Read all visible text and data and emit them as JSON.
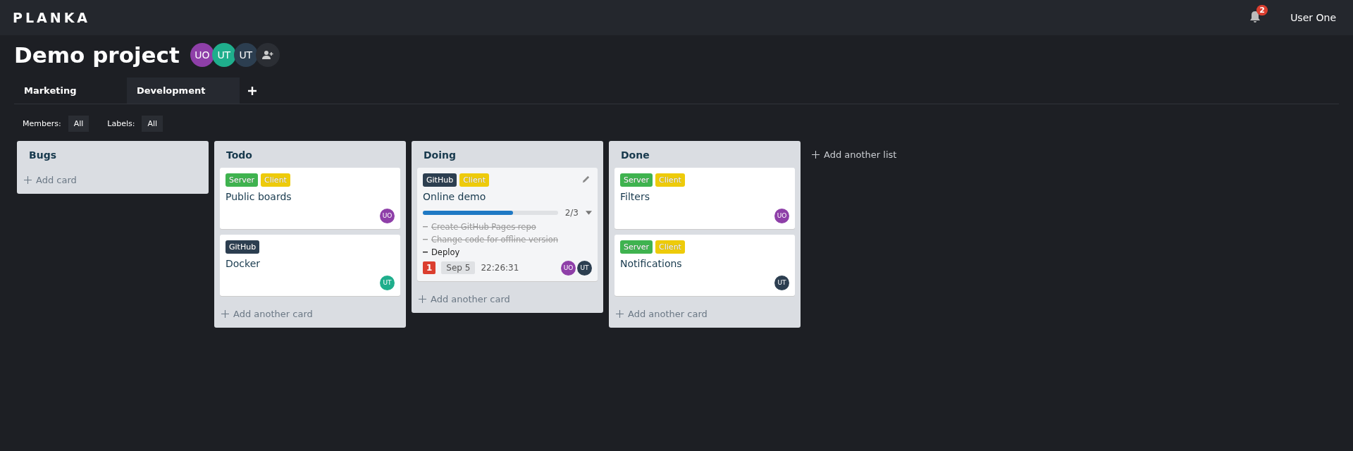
{
  "header": {
    "logo": "PLANKA",
    "notifications": "2",
    "user": "User One"
  },
  "project": {
    "title": "Demo project",
    "members": [
      {
        "initials": "UO",
        "color": "#8e3fa8"
      },
      {
        "initials": "UT",
        "color": "#1fae8c"
      },
      {
        "initials": "UT",
        "color": "#2c3e50"
      }
    ]
  },
  "tabs": [
    {
      "label": "Marketing",
      "selected": false
    },
    {
      "label": "Development",
      "selected": true
    }
  ],
  "filters": [
    {
      "label": "Members:",
      "value": "All"
    },
    {
      "label": "Labels:",
      "value": "All"
    }
  ],
  "lists": [
    {
      "title": "Bugs",
      "add": "Add card"
    },
    {
      "title": "Todo",
      "add": "Add another card",
      "cards": [
        {
          "labels": [
            {
              "text": "Server",
              "color": "#3fb34f"
            },
            {
              "text": "Client",
              "color": "#eecb0a"
            }
          ],
          "title": "Public boards",
          "hovered": false,
          "members": [
            {
              "initials": "UO",
              "color": "#8e3fa8"
            }
          ]
        },
        {
          "labels": [
            {
              "text": "GitHub",
              "color": "#2c3e50"
            }
          ],
          "title": "Docker",
          "hovered": false,
          "members": [
            {
              "initials": "UT",
              "color": "#1fae8c"
            }
          ]
        }
      ]
    },
    {
      "title": "Doing",
      "add": "Add another card",
      "cards": [
        {
          "labels": [
            {
              "text": "GitHub",
              "color": "#2c3e50"
            },
            {
              "text": "Client",
              "color": "#eecb0a"
            }
          ],
          "title": "Online demo",
          "hovered": true,
          "progress": {
            "level": 0.667,
            "reading": "2/3"
          },
          "tasks": [
            {
              "text": "Create GitHub Pages repo",
              "done": true
            },
            {
              "text": "Change code for offline version",
              "done": true
            },
            {
              "text": "Deploy",
              "done": false
            }
          ],
          "comments": "1",
          "due": "Sep 5",
          "timer": "22:26:31",
          "members": [
            {
              "initials": "UO",
              "color": "#8e3fa8"
            },
            {
              "initials": "UT",
              "color": "#2c3e50"
            }
          ]
        }
      ]
    },
    {
      "title": "Done",
      "add": "Add another card",
      "cards": [
        {
          "labels": [
            {
              "text": "Server",
              "color": "#3fb34f"
            },
            {
              "text": "Client",
              "color": "#eecb0a"
            }
          ],
          "title": "Filters",
          "hovered": false,
          "members": [
            {
              "initials": "UO",
              "color": "#8e3fa8"
            }
          ]
        },
        {
          "labels": [
            {
              "text": "Server",
              "color": "#3fb34f"
            },
            {
              "text": "Client",
              "color": "#eecb0a"
            }
          ],
          "title": "Notifications",
          "hovered": false,
          "members": [
            {
              "initials": "UT",
              "color": "#2c3e50"
            }
          ]
        }
      ]
    }
  ],
  "add_list": "Add another list"
}
